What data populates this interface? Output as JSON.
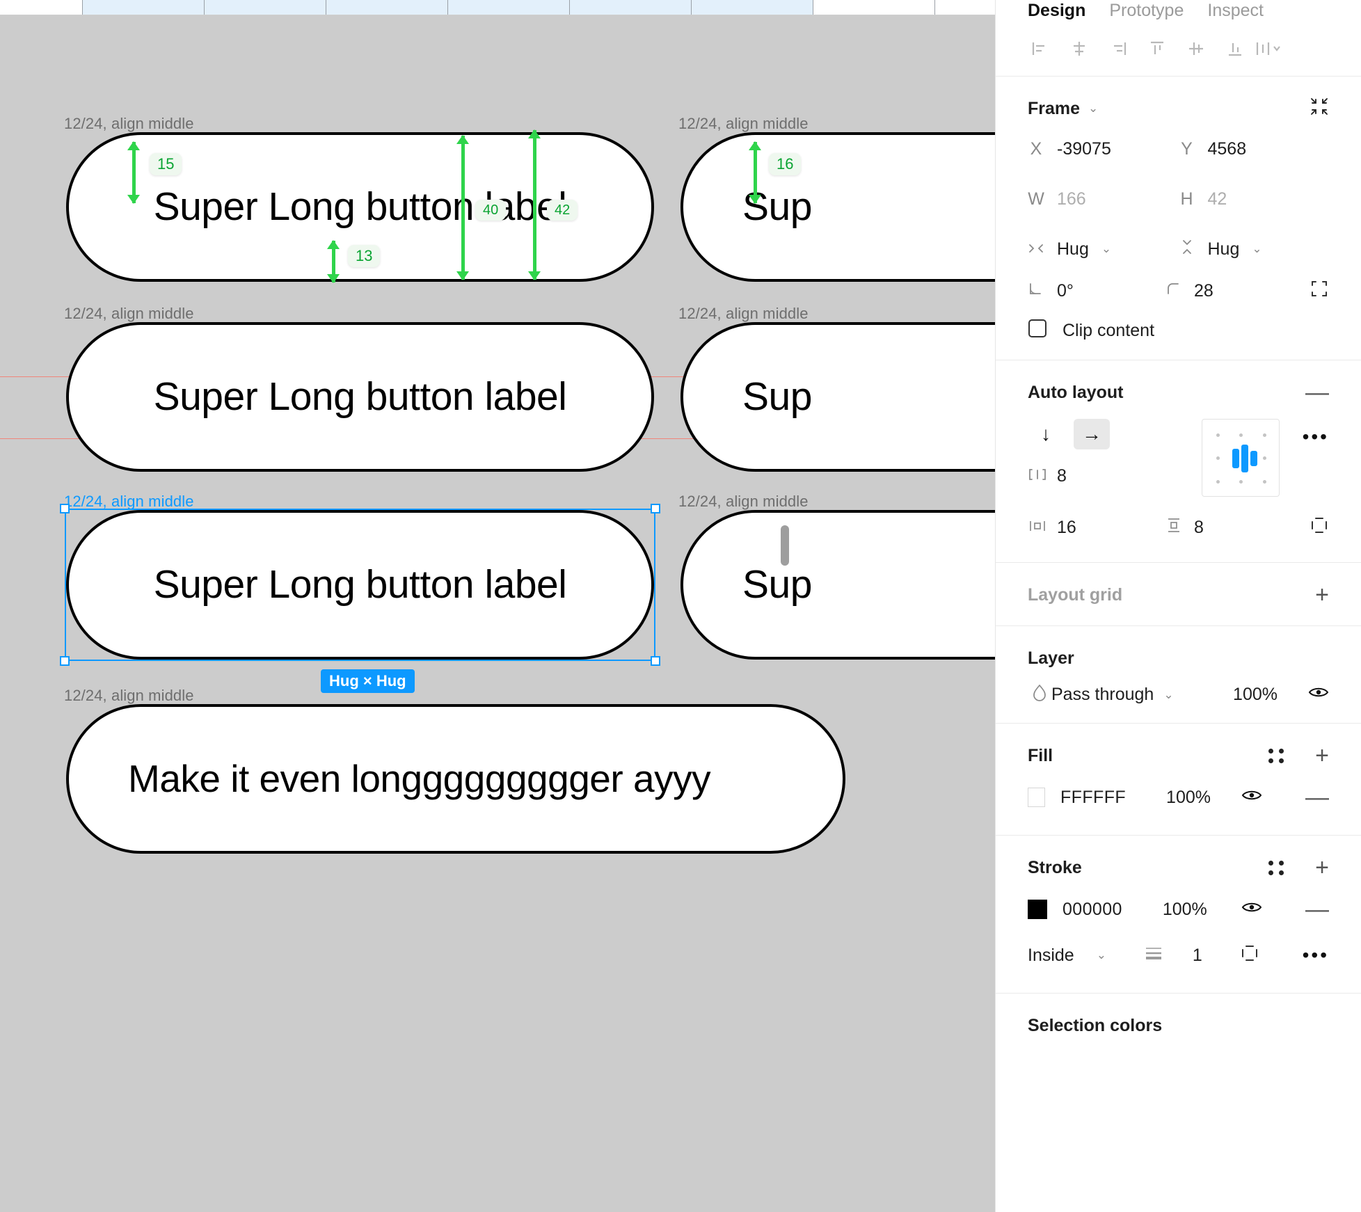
{
  "canvas": {
    "background_color": "#cccccc",
    "rows": [
      {
        "label": "12/24, align middle",
        "text": "Super Long button label",
        "selected": false
      },
      {
        "label": "12/24, align middle",
        "text": "Super Long button label",
        "selected": false
      },
      {
        "label": "12/24, align middle",
        "text": "Super Long button label",
        "selected": true
      },
      {
        "label": "12/24, align middle",
        "text": "Make it even longgggggggger ayyy",
        "selected": false
      }
    ],
    "right_column": [
      {
        "label": "12/24, align middle",
        "text": "Sup"
      },
      {
        "label": "12/24, align middle",
        "text": "Sup"
      },
      {
        "label": "12/24, align middle",
        "text": "Sup"
      }
    ],
    "measurements": [
      {
        "value": "15",
        "name": "top-padding"
      },
      {
        "value": "13",
        "name": "bottom-padding"
      },
      {
        "value": "40",
        "name": "content-height"
      },
      {
        "value": "42",
        "name": "frame-height"
      },
      {
        "value": "16",
        "name": "top-padding-right"
      }
    ],
    "selection_badge": "Hug × Hug",
    "guide_color": "#f0857a",
    "selection_color": "#0d99ff",
    "measure_color": "#2fd44b"
  },
  "panel": {
    "tabs": [
      {
        "label": "Design",
        "active": true
      },
      {
        "label": "Prototype",
        "active": false
      },
      {
        "label": "Inspect",
        "active": false
      }
    ],
    "align_tools": [
      "align-left-icon",
      "align-horizontal-center-icon",
      "align-right-icon",
      "align-top-icon",
      "align-vertical-center-icon",
      "align-bottom-icon",
      "distribute-more-icon"
    ],
    "frame": {
      "title": "Frame",
      "x_key": "X",
      "x_value": "-39075",
      "y_key": "Y",
      "y_value": "4568",
      "w_key": "W",
      "w_value": "166",
      "h_key": "H",
      "h_value": "42",
      "horizontal_resizing": "Hug",
      "vertical_resizing": "Hug",
      "rotation": "0°",
      "corner_radius": "28",
      "clip_content_label": "Clip content",
      "clip_content_checked": false
    },
    "auto_layout": {
      "title": "Auto layout",
      "direction_vertical": "↓",
      "direction_horizontal": "→",
      "direction_active": "horizontal",
      "gap": "8",
      "horizontal_padding": "16",
      "vertical_padding": "8",
      "alignment": "center"
    },
    "layout_grid": {
      "title": "Layout grid"
    },
    "layer": {
      "title": "Layer",
      "blend_mode": "Pass through",
      "opacity": "100%"
    },
    "fill": {
      "title": "Fill",
      "items": [
        {
          "hex": "FFFFFF",
          "opacity": "100%",
          "color": "#ffffff"
        }
      ]
    },
    "stroke": {
      "title": "Stroke",
      "items": [
        {
          "hex": "000000",
          "opacity": "100%",
          "color": "#000000"
        }
      ],
      "position": "Inside",
      "weight": "1"
    },
    "selection_colors": {
      "title": "Selection colors"
    }
  }
}
